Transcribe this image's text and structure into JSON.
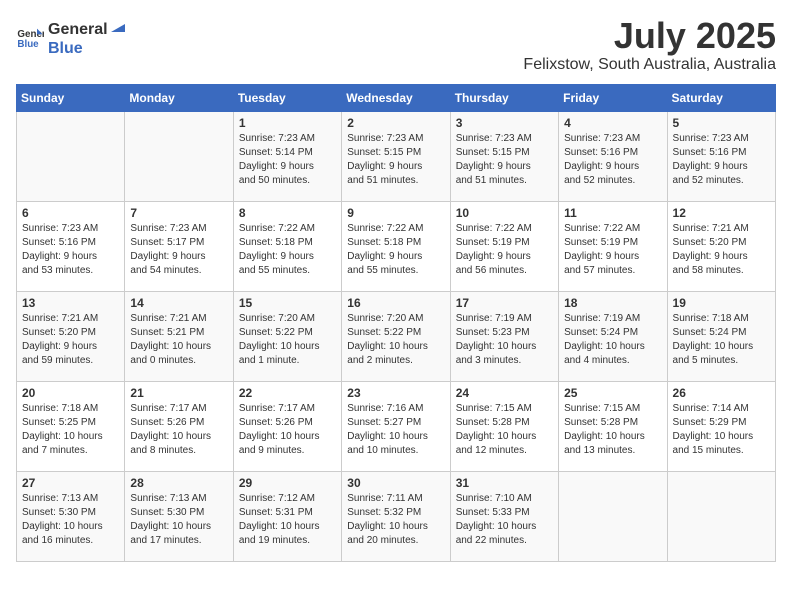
{
  "header": {
    "logo_general": "General",
    "logo_blue": "Blue",
    "month_title": "July 2025",
    "location": "Felixstow, South Australia, Australia"
  },
  "weekdays": [
    "Sunday",
    "Monday",
    "Tuesday",
    "Wednesday",
    "Thursday",
    "Friday",
    "Saturday"
  ],
  "weeks": [
    [
      {
        "day": "",
        "info": ""
      },
      {
        "day": "",
        "info": ""
      },
      {
        "day": "1",
        "info": "Sunrise: 7:23 AM\nSunset: 5:14 PM\nDaylight: 9 hours\nand 50 minutes."
      },
      {
        "day": "2",
        "info": "Sunrise: 7:23 AM\nSunset: 5:15 PM\nDaylight: 9 hours\nand 51 minutes."
      },
      {
        "day": "3",
        "info": "Sunrise: 7:23 AM\nSunset: 5:15 PM\nDaylight: 9 hours\nand 51 minutes."
      },
      {
        "day": "4",
        "info": "Sunrise: 7:23 AM\nSunset: 5:16 PM\nDaylight: 9 hours\nand 52 minutes."
      },
      {
        "day": "5",
        "info": "Sunrise: 7:23 AM\nSunset: 5:16 PM\nDaylight: 9 hours\nand 52 minutes."
      }
    ],
    [
      {
        "day": "6",
        "info": "Sunrise: 7:23 AM\nSunset: 5:16 PM\nDaylight: 9 hours\nand 53 minutes."
      },
      {
        "day": "7",
        "info": "Sunrise: 7:23 AM\nSunset: 5:17 PM\nDaylight: 9 hours\nand 54 minutes."
      },
      {
        "day": "8",
        "info": "Sunrise: 7:22 AM\nSunset: 5:18 PM\nDaylight: 9 hours\nand 55 minutes."
      },
      {
        "day": "9",
        "info": "Sunrise: 7:22 AM\nSunset: 5:18 PM\nDaylight: 9 hours\nand 55 minutes."
      },
      {
        "day": "10",
        "info": "Sunrise: 7:22 AM\nSunset: 5:19 PM\nDaylight: 9 hours\nand 56 minutes."
      },
      {
        "day": "11",
        "info": "Sunrise: 7:22 AM\nSunset: 5:19 PM\nDaylight: 9 hours\nand 57 minutes."
      },
      {
        "day": "12",
        "info": "Sunrise: 7:21 AM\nSunset: 5:20 PM\nDaylight: 9 hours\nand 58 minutes."
      }
    ],
    [
      {
        "day": "13",
        "info": "Sunrise: 7:21 AM\nSunset: 5:20 PM\nDaylight: 9 hours\nand 59 minutes."
      },
      {
        "day": "14",
        "info": "Sunrise: 7:21 AM\nSunset: 5:21 PM\nDaylight: 10 hours\nand 0 minutes."
      },
      {
        "day": "15",
        "info": "Sunrise: 7:20 AM\nSunset: 5:22 PM\nDaylight: 10 hours\nand 1 minute."
      },
      {
        "day": "16",
        "info": "Sunrise: 7:20 AM\nSunset: 5:22 PM\nDaylight: 10 hours\nand 2 minutes."
      },
      {
        "day": "17",
        "info": "Sunrise: 7:19 AM\nSunset: 5:23 PM\nDaylight: 10 hours\nand 3 minutes."
      },
      {
        "day": "18",
        "info": "Sunrise: 7:19 AM\nSunset: 5:24 PM\nDaylight: 10 hours\nand 4 minutes."
      },
      {
        "day": "19",
        "info": "Sunrise: 7:18 AM\nSunset: 5:24 PM\nDaylight: 10 hours\nand 5 minutes."
      }
    ],
    [
      {
        "day": "20",
        "info": "Sunrise: 7:18 AM\nSunset: 5:25 PM\nDaylight: 10 hours\nand 7 minutes."
      },
      {
        "day": "21",
        "info": "Sunrise: 7:17 AM\nSunset: 5:26 PM\nDaylight: 10 hours\nand 8 minutes."
      },
      {
        "day": "22",
        "info": "Sunrise: 7:17 AM\nSunset: 5:26 PM\nDaylight: 10 hours\nand 9 minutes."
      },
      {
        "day": "23",
        "info": "Sunrise: 7:16 AM\nSunset: 5:27 PM\nDaylight: 10 hours\nand 10 minutes."
      },
      {
        "day": "24",
        "info": "Sunrise: 7:15 AM\nSunset: 5:28 PM\nDaylight: 10 hours\nand 12 minutes."
      },
      {
        "day": "25",
        "info": "Sunrise: 7:15 AM\nSunset: 5:28 PM\nDaylight: 10 hours\nand 13 minutes."
      },
      {
        "day": "26",
        "info": "Sunrise: 7:14 AM\nSunset: 5:29 PM\nDaylight: 10 hours\nand 15 minutes."
      }
    ],
    [
      {
        "day": "27",
        "info": "Sunrise: 7:13 AM\nSunset: 5:30 PM\nDaylight: 10 hours\nand 16 minutes."
      },
      {
        "day": "28",
        "info": "Sunrise: 7:13 AM\nSunset: 5:30 PM\nDaylight: 10 hours\nand 17 minutes."
      },
      {
        "day": "29",
        "info": "Sunrise: 7:12 AM\nSunset: 5:31 PM\nDaylight: 10 hours\nand 19 minutes."
      },
      {
        "day": "30",
        "info": "Sunrise: 7:11 AM\nSunset: 5:32 PM\nDaylight: 10 hours\nand 20 minutes."
      },
      {
        "day": "31",
        "info": "Sunrise: 7:10 AM\nSunset: 5:33 PM\nDaylight: 10 hours\nand 22 minutes."
      },
      {
        "day": "",
        "info": ""
      },
      {
        "day": "",
        "info": ""
      }
    ]
  ]
}
